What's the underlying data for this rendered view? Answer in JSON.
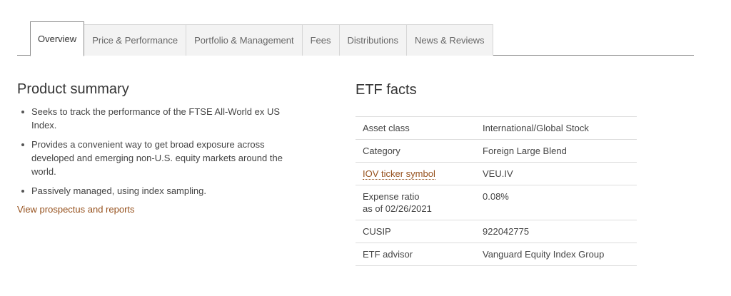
{
  "tabs": [
    {
      "label": "Overview",
      "active": true
    },
    {
      "label": "Price & Performance",
      "active": false
    },
    {
      "label": "Portfolio & Management",
      "active": false
    },
    {
      "label": "Fees",
      "active": false
    },
    {
      "label": "Distributions",
      "active": false
    },
    {
      "label": "News & Reviews",
      "active": false
    }
  ],
  "product_summary": {
    "title": "Product summary",
    "bullets": [
      "Seeks to track the performance of the FTSE All-World ex US Index.",
      "Provides a convenient way to get broad exposure across developed and emerging non-U.S. equity markets around the world.",
      "Passively managed, using index sampling."
    ],
    "link_label": "View prospectus and reports"
  },
  "etf_facts": {
    "title": "ETF facts",
    "rows": [
      {
        "label": "Asset class",
        "label_sub": "",
        "value": "International/Global Stock"
      },
      {
        "label": "Category",
        "label_sub": "",
        "value": "Foreign Large Blend"
      },
      {
        "label": "IOV ticker symbol",
        "label_sub": "",
        "value": "VEU.IV"
      },
      {
        "label": "Expense ratio",
        "label_sub": "as of 02/26/2021",
        "value": "0.08%"
      },
      {
        "label": "CUSIP",
        "label_sub": "",
        "value": "922042775"
      },
      {
        "label": "ETF advisor",
        "label_sub": "",
        "value": "Vanguard Equity Index Group"
      }
    ]
  },
  "colors": {
    "link": "#96511d",
    "tab_inactive_bg": "#f3f3f3",
    "border": "#8c8c8c"
  }
}
